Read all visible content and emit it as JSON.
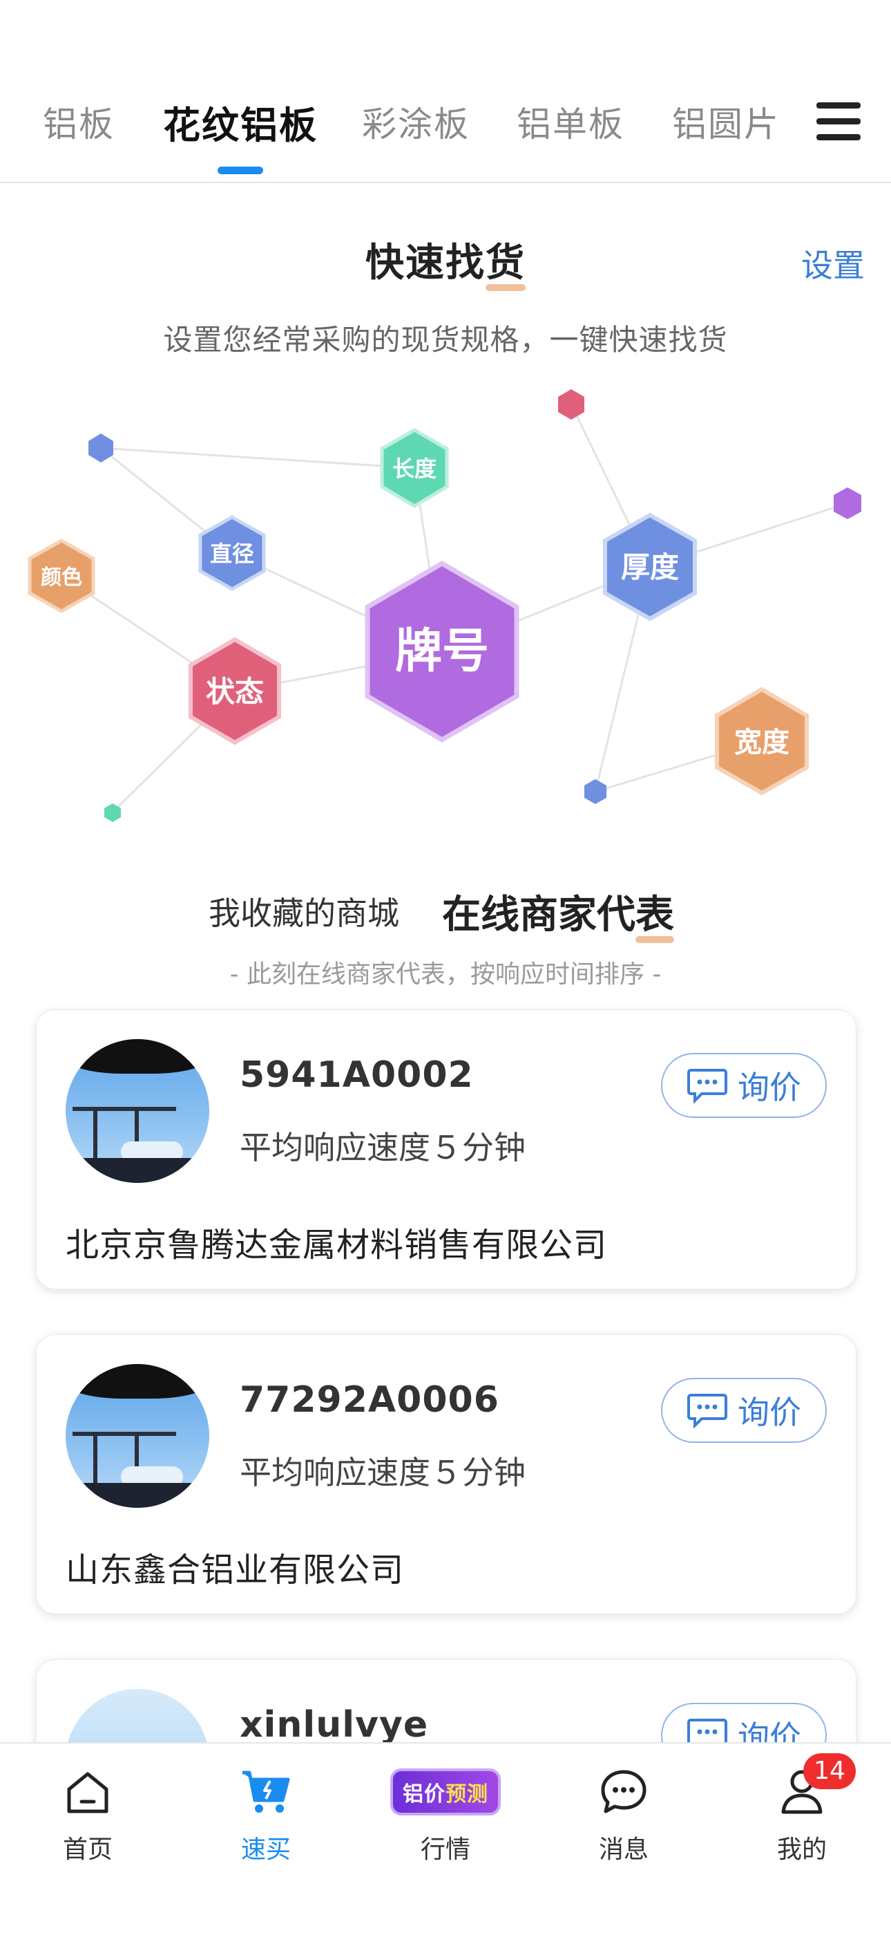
{
  "tabs": [
    {
      "label": "铝板"
    },
    {
      "label": "花纹铝板"
    },
    {
      "label": "彩涂板"
    },
    {
      "label": "铝单板"
    },
    {
      "label": "铝圆片"
    }
  ],
  "active_tab_index": 1,
  "quick_find": {
    "title_a": "快速找",
    "title_b": "货",
    "settings_label": "设置",
    "subtitle": "设置您经常采购的现货规格，一键快速找货",
    "nodes": {
      "grade": "牌号",
      "state": "状态",
      "thickness": "厚度",
      "width": "宽度",
      "length": "长度",
      "diameter": "直径",
      "color": "颜色"
    }
  },
  "merchants_section": {
    "fav_tab": "我收藏的商城",
    "online_tab_a": "在线商家代",
    "online_tab_b": "表",
    "subtitle": "- 此刻在线商家代表，按响应时间排序 -",
    "ask_label": "询价"
  },
  "merchants": [
    {
      "name": "5941A0002",
      "speed": "平均响应速度５分钟",
      "company": "北京京鲁腾达金属材料销售有限公司"
    },
    {
      "name": "77292A0006",
      "speed": "平均响应速度５分钟",
      "company": "山东鑫合铝业有限公司"
    },
    {
      "name": "xinlulvye",
      "speed": "",
      "company": ""
    }
  ],
  "bottom_nav": {
    "home": "首页",
    "quick_buy": "速买",
    "market": "行情",
    "market_badge_a": "铝价",
    "market_badge_b": "预测",
    "messages": "消息",
    "mine": "我的",
    "mine_badge": "14"
  },
  "colors": {
    "accent": "#1a8cf0",
    "link": "#3b7ed8",
    "badge": "#f02d2d",
    "hex_purple": "#b06be0",
    "hex_pink": "#e0607a",
    "hex_blue": "#6f8fe0",
    "hex_orange": "#e8a06a",
    "hex_green": "#5ed8b3"
  }
}
